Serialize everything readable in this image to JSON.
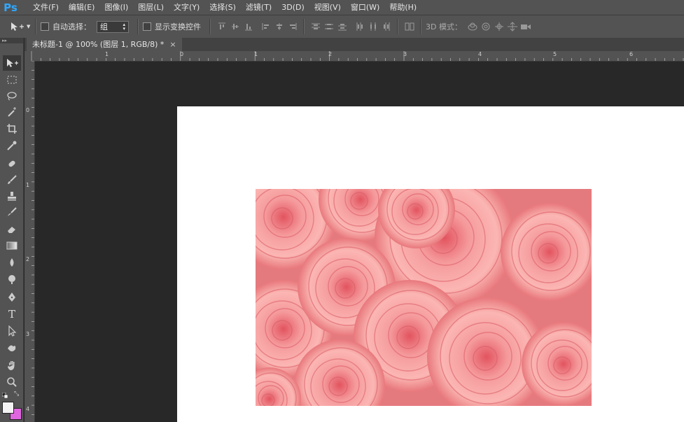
{
  "app": {
    "logo": "Ps"
  },
  "menu": [
    "文件(F)",
    "编辑(E)",
    "图像(I)",
    "图层(L)",
    "文字(Y)",
    "选择(S)",
    "滤镜(T)",
    "3D(D)",
    "视图(V)",
    "窗口(W)",
    "帮助(H)"
  ],
  "options": {
    "auto_select_label": "自动选择：",
    "auto_select_value": "组",
    "show_transform_label": "显示变换控件",
    "mode_3d_label": "3D 模式："
  },
  "document_tab": {
    "title": "未标题-1 @ 100% (图层 1, RGB/8) *",
    "close": "×"
  },
  "ruler": {
    "h_labels": [
      "1",
      "0",
      "1",
      "2",
      "3",
      "4",
      "5",
      "6"
    ],
    "v_labels": [
      "0",
      "1",
      "2",
      "3",
      "4"
    ]
  },
  "colors": {
    "foreground": "#f3f3f3",
    "background": "#e066e0",
    "ps_blue": "#31a8ff"
  },
  "tools": [
    "move-tool",
    "marquee-tool",
    "lasso-tool",
    "magic-wand-tool",
    "crop-tool",
    "eyedropper-tool",
    "healing-brush-tool",
    "brush-tool",
    "clone-stamp-tool",
    "history-brush-tool",
    "eraser-tool",
    "gradient-tool",
    "blur-tool",
    "dodge-tool",
    "pen-tool",
    "type-tool",
    "path-selection-tool",
    "shape-tool",
    "hand-tool",
    "zoom-tool"
  ]
}
